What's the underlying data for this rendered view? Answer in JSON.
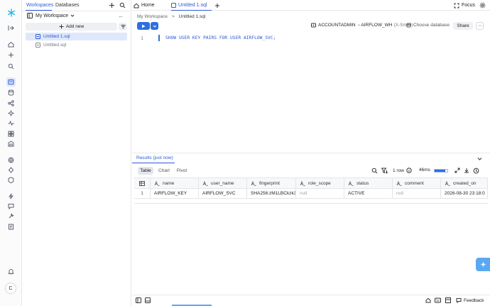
{
  "sidebar_tabs": {
    "workspaces": "Workspaces",
    "databases": "Databases"
  },
  "workspace": {
    "name": "My Workspace",
    "add_new": "Add new",
    "files": [
      "Untitled 1.sql",
      "Untitled.sql"
    ]
  },
  "rail": {
    "user_initial": "C"
  },
  "top": {
    "home": "Home",
    "active_tab": "Untitled 1.sql",
    "focus": "Focus"
  },
  "editor": {
    "breadcrumb_root": "My Workspace",
    "breadcrumb_sep": ">",
    "breadcrumb_file": "Untitled 1.sql",
    "role": "ACCOUNTADMIN",
    "warehouse": "AIRFLOW_WH",
    "warehouse_size": "(X-Small)",
    "choose_db": "Choose database",
    "share": "Share",
    "line_number": "1",
    "sql": "SHOW USER KEY PAIRS FOR USER AIRFLOW_SVC;"
  },
  "results": {
    "title": "Results (just now)",
    "views": [
      "Table",
      "Chart",
      "Pivot"
    ],
    "row_count": "1 row",
    "duration": "46ms",
    "progress": 0.85,
    "columns": [
      "name",
      "user_name",
      "fingerprint",
      "role_scope",
      "status",
      "comment",
      "created_on"
    ],
    "rows": [
      {
        "index": "1",
        "cells": [
          "AIRFLOW_KEY",
          "AIRFLOW_SVC",
          "SHA256:zM1LBCkzk32",
          "null",
          "ACTIVE",
          "null",
          "2026-08-30 23:18:0"
        ]
      }
    ]
  },
  "footer": {
    "feedback": "Feedback"
  },
  "colors": {
    "accent": "#2d5bd6",
    "null_text": "#a0a4ac",
    "fab": "#5aa9f0"
  }
}
